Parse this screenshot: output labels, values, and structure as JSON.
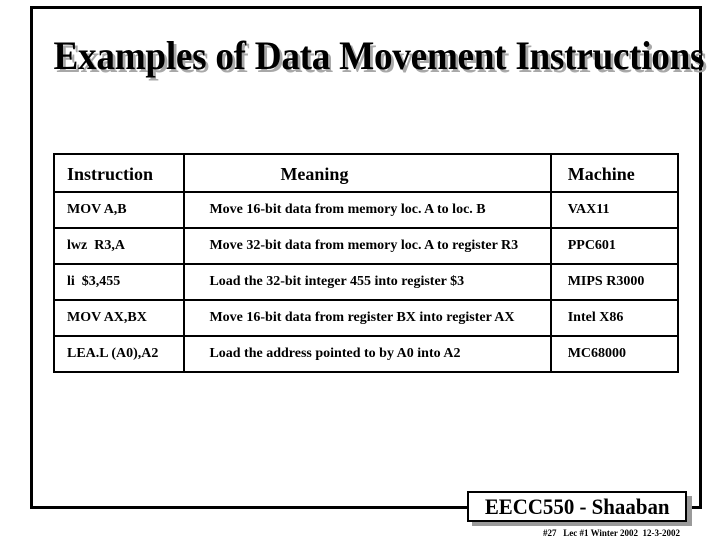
{
  "slide": {
    "title": "Examples of Data Movement Instructions"
  },
  "table": {
    "headers": {
      "instruction": "Instruction",
      "meaning": "Meaning",
      "machine": "Machine"
    },
    "rows": [
      {
        "instruction": "MOV A,B",
        "meaning": "Move 16-bit data from memory loc. A to loc. B",
        "machine": "VAX11"
      },
      {
        "instruction": "lwz  R3,A",
        "meaning": "Move 32-bit data from memory loc. A to register R3",
        "machine": "PPC601"
      },
      {
        "instruction": "li  $3,455",
        "meaning": "Load the 32-bit integer 455 into register $3",
        "machine": "MIPS R3000"
      },
      {
        "instruction": "MOV AX,BX",
        "meaning": "Move 16-bit data from register BX into register AX",
        "machine": "Intel X86"
      },
      {
        "instruction": "LEA.L (A0),A2",
        "meaning": "Load the address pointed to by A0 into A2",
        "machine": "MC68000"
      }
    ]
  },
  "footer": {
    "badge": "EECC550 - Shaaban",
    "info": "#27   Lec #1 Winter 2002  12-3-2002"
  }
}
